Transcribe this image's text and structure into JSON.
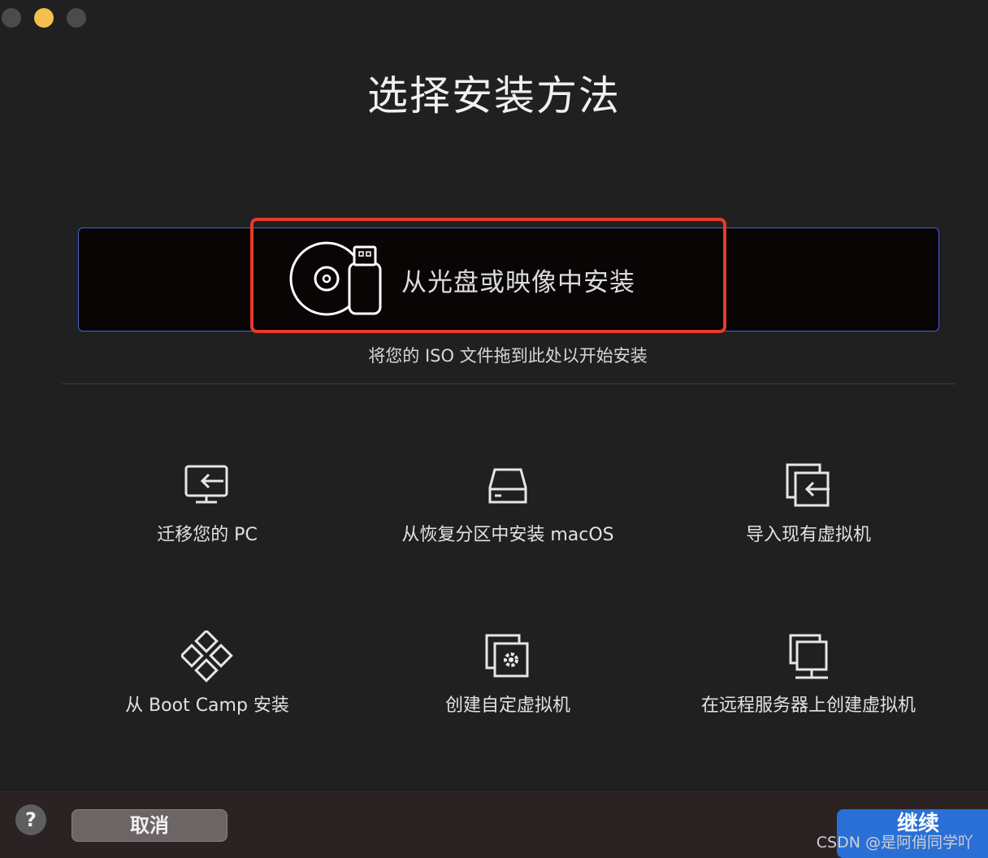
{
  "window": {
    "title": "选择安装方法"
  },
  "drop_zone": {
    "label": "从光盘或映像中安装",
    "hint": "将您的 ISO 文件拖到此处以开始安装"
  },
  "options": [
    {
      "label": "迁移您的 PC",
      "icon": "migrate-pc-icon"
    },
    {
      "label": "从恢复分区中安装 macOS",
      "icon": "drive-icon"
    },
    {
      "label": "导入现有虚拟机",
      "icon": "import-vm-icon"
    },
    {
      "label": "从 Boot Camp 安装",
      "icon": "bootcamp-icon"
    },
    {
      "label": "创建自定虚拟机",
      "icon": "custom-vm-icon"
    },
    {
      "label": "在远程服务器上创建虚拟机",
      "icon": "remote-server-icon"
    }
  ],
  "footer": {
    "help_label": "?",
    "cancel_label": "取消",
    "continue_label": "继续"
  },
  "watermark": "CSDN @是阿俏同学吖",
  "colors": {
    "background": "#202020",
    "drop_zone_border": "#4a62c8",
    "highlight": "#e8392b",
    "primary": "#2a6fd6",
    "minimize": "#f4bf4f"
  }
}
